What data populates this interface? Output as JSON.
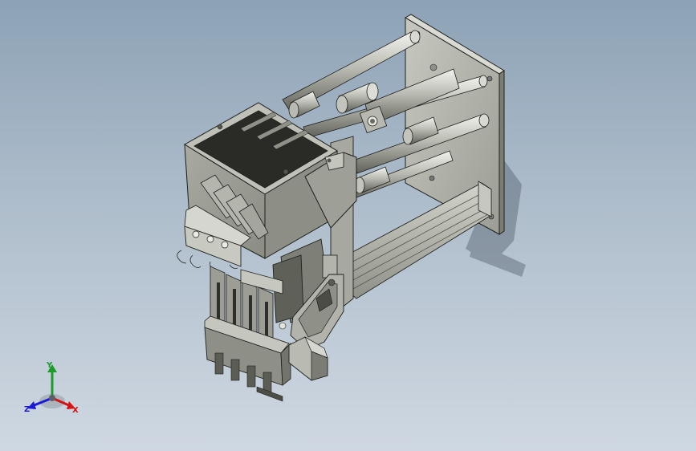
{
  "triad": {
    "y_label": "Y",
    "z_label": "Z",
    "x_label": "X",
    "colors": {
      "x": "#d41414",
      "y": "#1c9a2a",
      "z": "#1b1bd6"
    }
  },
  "colors": {
    "background_top": "#8da2b6",
    "background_bottom": "#cfd8e2",
    "metal_light": "#c9cbc2",
    "metal_mid": "#9a9c91",
    "metal_dark": "#6a6c63",
    "edge": "#1e1f1b"
  }
}
